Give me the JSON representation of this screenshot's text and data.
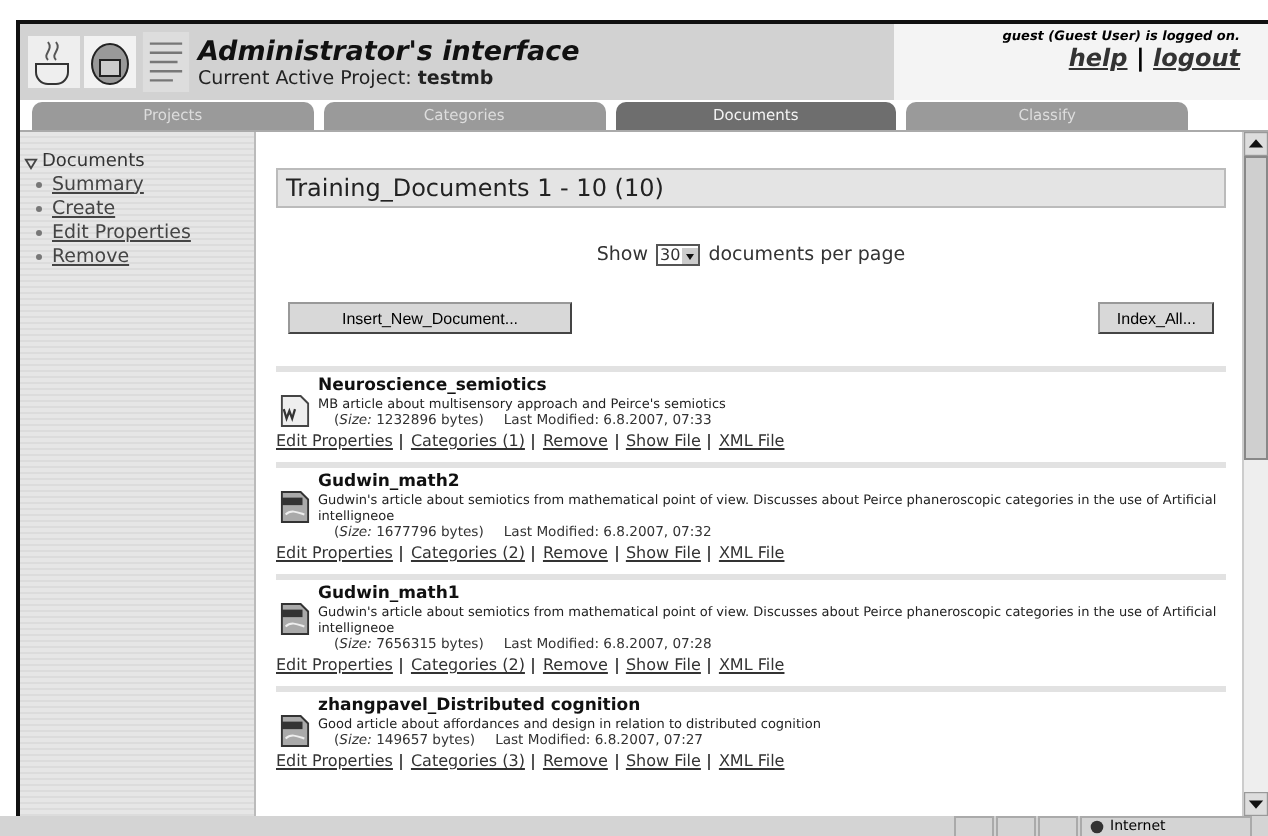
{
  "header": {
    "title": "Administrator's interface",
    "project_label": "Current Active Project:",
    "project": "testmb",
    "user_status": "guest (Guest User) is logged on.",
    "links": [
      "help",
      "logout"
    ],
    "separator": "|"
  },
  "tabs": [
    {
      "label": "Projects",
      "selected": false
    },
    {
      "label": "Categories",
      "selected": false
    },
    {
      "label": "Documents",
      "selected": true
    },
    {
      "label": "Classify",
      "selected": false
    }
  ],
  "sidebar": {
    "heading": "Documents",
    "expanded": true,
    "items": [
      "Summary",
      "Create",
      "Edit Properties",
      "Remove"
    ]
  },
  "content": {
    "heading": "Training_Documents 1 - 10 (10)",
    "show_label": "Show",
    "per_page": "30",
    "per_page_suffix": "documents per page",
    "buttons": [
      "Insert_New_Document...",
      "Index_All..."
    ],
    "documents": [
      {
        "kind": "word",
        "title": "Neuroscience_semiotics",
        "description": "MB article about multisensory approach and Peirce's semiotics",
        "size": "(*Size:* 1232896 bytes)",
        "modified": "Last Modified: 6.8.2007, 07:33",
        "links": [
          "Edit Properties",
          "Categories (1)",
          "Remove",
          "Show File",
          "XML File"
        ]
      },
      {
        "kind": "pdf",
        "title": "Gudwin_math2",
        "description": "Gudwin's article about semiotics from mathematical point of view. Discusses about Peirce phaneroscopic categories in the use of Artificial intelligneoe",
        "size": "(*Size:* 1677796 bytes)",
        "modified": "Last Modified: 6.8.2007, 07:32",
        "links": [
          "Edit Properties",
          "Categories (2)",
          "Remove",
          "Show File",
          "XML File"
        ]
      },
      {
        "kind": "pdf",
        "title": "Gudwin_math1",
        "description": "Gudwin's article about semiotics from mathematical point of view. Discusses about Peirce phaneroscopic categories in the use of Artificial intelligneoe",
        "size": "(*Size:* 7656315 bytes)",
        "modified": "Last Modified: 6.8.2007, 07:28",
        "links": [
          "Edit Properties",
          "Categories (2)",
          "Remove",
          "Show File",
          "XML File"
        ]
      },
      {
        "kind": "pdf",
        "title": "zhangpavel_Distributed cognition",
        "description": "Good article about affordances and design in relation to distributed cognition",
        "size": "(*Size:* 149657 bytes)",
        "modified": "Last Modified: 6.8.2007, 07:27",
        "links": [
          "Edit Properties",
          "Categories (3)",
          "Remove",
          "Show File",
          "XML File"
        ]
      }
    ]
  },
  "status_bar": {
    "zone": "Internet"
  }
}
